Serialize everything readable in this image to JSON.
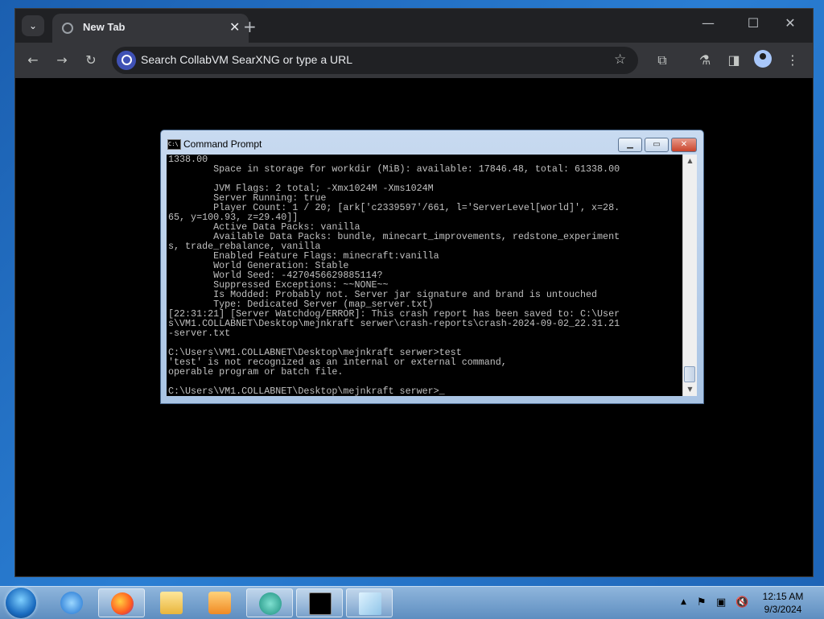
{
  "browser": {
    "tab_title": "New Tab",
    "tab_close": "✕",
    "new_tab": "+",
    "omnibox_placeholder": "Search CollabVM SearXNG or type a URL",
    "window_controls": {
      "minimize": "—",
      "maximize": "☐",
      "close": "✕"
    }
  },
  "cmd": {
    "title": "Command Prompt",
    "icon_text": "C:\\",
    "lines": [
      "1338.00",
      "        Space in storage for workdir (MiB): available: 17846.48, total: 61338.00",
      "",
      "        JVM Flags: 2 total; -Xmx1024M -Xms1024M",
      "        Server Running: true",
      "        Player Count: 1 / 20; [ark['c2339597'/661, l='ServerLevel[world]', x=28.",
      "65, y=100.93, z=29.40]]",
      "        Active Data Packs: vanilla",
      "        Available Data Packs: bundle, minecart_improvements, redstone_experiment",
      "s, trade_rebalance, vanilla",
      "        Enabled Feature Flags: minecraft:vanilla",
      "        World Generation: Stable",
      "        World Seed: -4270456629885114?",
      "        Suppressed Exceptions: ~~NONE~~",
      "        Is Modded: Probably not. Server jar signature and brand is untouched",
      "        Type: Dedicated Server (map_server.txt)",
      "[22:31:21] [Server Watchdog/ERROR]: This crash report has been saved to: C:\\User",
      "s\\VM1.COLLABNET\\Desktop\\mejnkraft serwer\\crash-reports\\crash-2024-09-02_22.31.21",
      "-server.txt",
      "",
      "C:\\Users\\VM1.COLLABNET\\Desktop\\mejnkraft serwer>test",
      "'test' is not recognized as an internal or external command,",
      "operable program or batch file.",
      "",
      "C:\\Users\\VM1.COLLABNET\\Desktop\\mejnkraft serwer>_"
    ]
  },
  "taskbar": {
    "clock_time": "12:15 AM",
    "clock_date": "9/3/2024"
  },
  "colors": {
    "chrome_dark": "#202124",
    "chrome_toolbar": "#35363a",
    "console_bg": "#000000",
    "console_fg": "#c0c0c0"
  }
}
